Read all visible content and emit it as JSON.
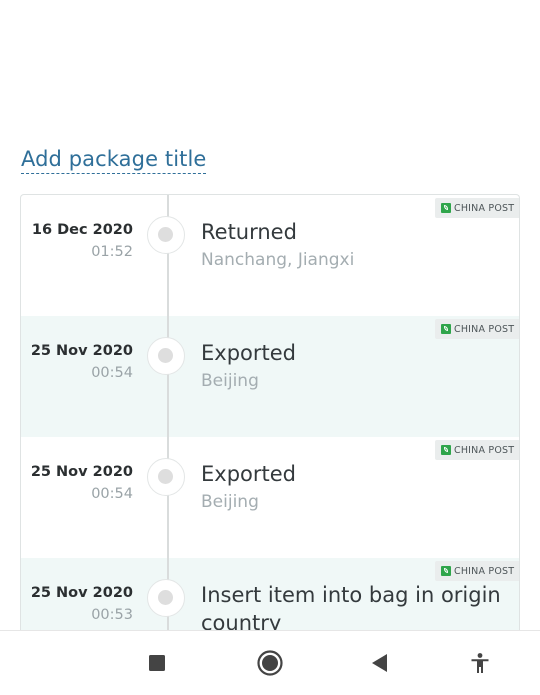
{
  "header": {
    "add_title_link": "Add package title"
  },
  "events": [
    {
      "date": "16 Dec 2020",
      "time": "01:52",
      "status": "Returned",
      "location": "Nanchang, Jiangxi",
      "carrier": "CHINA POST"
    },
    {
      "date": "25 Nov 2020",
      "time": "00:54",
      "status": "Exported",
      "location": "Beijing",
      "carrier": "CHINA POST"
    },
    {
      "date": "25 Nov 2020",
      "time": "00:54",
      "status": "Exported",
      "location": "Beijing",
      "carrier": "CHINA POST"
    },
    {
      "date": "25 Nov 2020",
      "time": "00:53",
      "status": "Insert item into bag in origin country",
      "location": "",
      "carrier": "CHINA POST"
    }
  ],
  "colors": {
    "link": "#2f6f99",
    "alt_row_bg": "#f0f8f7",
    "carrier_logo": "#2fa54b",
    "nav_icons": "#444444"
  },
  "navbar": {
    "icons": [
      "recent-apps-icon",
      "home-icon",
      "back-icon",
      "accessibility-icon"
    ]
  }
}
